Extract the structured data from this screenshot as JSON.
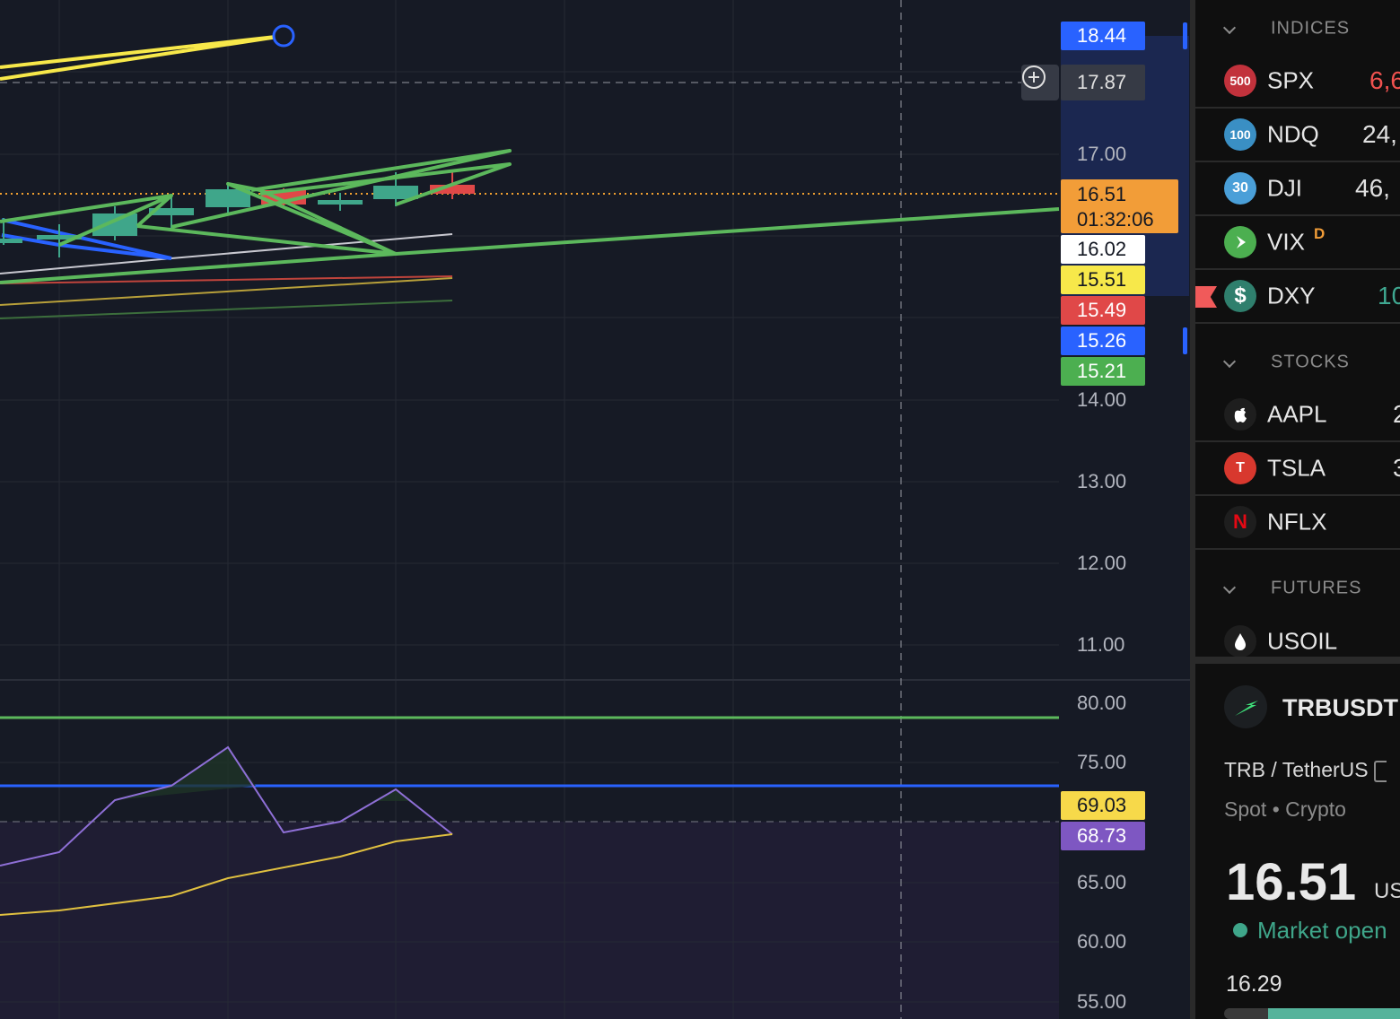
{
  "chart": {
    "price_axis": [
      "17.00",
      "14.00",
      "13.00",
      "12.00",
      "11.00"
    ],
    "rsi_axis": [
      "80.00",
      "75.00",
      "65.00",
      "60.00",
      "55.00"
    ],
    "tags": [
      {
        "name": "tag-18-44",
        "text": "18.44",
        "bg": "#2962ff",
        "fg": "#ffffff"
      },
      {
        "name": "tag-crosshair",
        "text": "17.87",
        "bg": "#363a45",
        "fg": "#e0e0e0"
      },
      {
        "name": "tag-16-02",
        "text": "16.02",
        "bg": "#ffffff",
        "fg": "#131722"
      },
      {
        "name": "tag-15-51",
        "text": "15.51",
        "bg": "#f7e84a",
        "fg": "#131722"
      },
      {
        "name": "tag-15-49",
        "text": "15.49",
        "bg": "#e04848",
        "fg": "#ffffff"
      },
      {
        "name": "tag-15-26",
        "text": "15.26",
        "bg": "#2962ff",
        "fg": "#ffffff"
      },
      {
        "name": "tag-15-21",
        "text": "15.21",
        "bg": "#4caf50",
        "fg": "#ffffff"
      },
      {
        "name": "tag-rsi-ma",
        "text": "69.03",
        "bg": "#f7d94a",
        "fg": "#131722"
      },
      {
        "name": "tag-rsi",
        "text": "68.73",
        "bg": "#7e57c2",
        "fg": "#ffffff"
      }
    ],
    "last_price": "16.51",
    "countdown": "01:32:06"
  },
  "watchlist": {
    "sections": [
      "INDICES",
      "STOCKS",
      "FUTURES"
    ],
    "items": [
      {
        "sym": "SPX",
        "badge": "500",
        "color": "#c2323c",
        "val": "6,6",
        "valColor": "#f0524f"
      },
      {
        "sym": "NDQ",
        "badge": "100",
        "color": "#3a8fc4",
        "val": "24,",
        "valColor": "#e0e0e0"
      },
      {
        "sym": "DJI",
        "badge": "30",
        "color": "#4a9fd8",
        "val": "46,",
        "valColor": "#e0e0e0"
      },
      {
        "sym": "VIX",
        "badge": "",
        "color": "#4caf50",
        "val": "",
        "sup": "D"
      },
      {
        "sym": "DXY",
        "badge": "$",
        "color": "#2f7f6d",
        "val": "10",
        "valColor": "#3fa891"
      },
      {
        "sym": "AAPL",
        "badge": "",
        "color": "#1e1e1e",
        "val": "2"
      },
      {
        "sym": "TSLA",
        "badge": "T",
        "color": "#d8382e",
        "val": "3"
      },
      {
        "sym": "NFLX",
        "badge": "N",
        "color": "#1e1e1e",
        "val": ""
      },
      {
        "sym": "USOIL",
        "badge": "",
        "color": "#1e1e1e",
        "val": ""
      }
    ]
  },
  "details": {
    "symbol": "TRBUSDT",
    "name": "TRB / TetherUS",
    "type": "Spot",
    "category": "Crypto",
    "price": "16.51",
    "currency": "US",
    "status": "Market open",
    "low": "16.29",
    "range_position": 0.25
  }
}
